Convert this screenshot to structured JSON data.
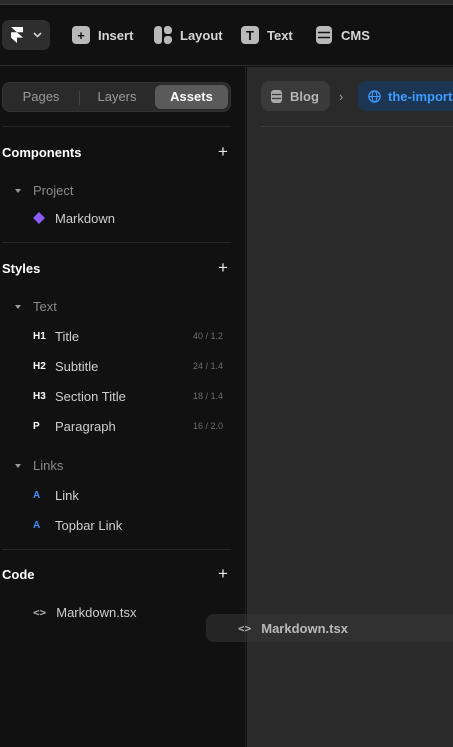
{
  "toolbar": {
    "items": [
      {
        "label": "Insert",
        "icon": "plus-square-icon"
      },
      {
        "label": "Layout",
        "icon": "layout-grid-icon"
      },
      {
        "label": "Text",
        "icon": "text-t-icon"
      },
      {
        "label": "CMS",
        "icon": "database-icon"
      }
    ]
  },
  "sidebar": {
    "tabs": [
      "Pages",
      "Layers",
      "Assets"
    ],
    "active_tab": "Assets",
    "components": {
      "title": "Components",
      "group": "Project",
      "items": [
        {
          "label": "Markdown",
          "icon": "component-diamond-icon"
        }
      ]
    },
    "styles": {
      "title": "Styles",
      "text_group": "Text",
      "text_items": [
        {
          "tag": "H1",
          "label": "Title",
          "meta": "40 / 1.2"
        },
        {
          "tag": "H2",
          "label": "Subtitle",
          "meta": "24 / 1.4"
        },
        {
          "tag": "H3",
          "label": "Section Title",
          "meta": "18 / 1.4"
        },
        {
          "tag": "P",
          "label": "Paragraph",
          "meta": "16 / 2.0"
        }
      ],
      "links_group": "Links",
      "link_items": [
        {
          "tag": "A",
          "label": "Link"
        },
        {
          "tag": "A",
          "label": "Topbar Link"
        }
      ]
    },
    "code": {
      "title": "Code",
      "items": [
        {
          "label": "Markdown.tsx",
          "icon": "code-brackets-icon"
        }
      ]
    }
  },
  "canvas": {
    "breadcrumb": {
      "first": "Blog",
      "second": "the-importa"
    }
  },
  "drag_ghost": {
    "label": "Markdown.tsx"
  },
  "colors": {
    "accent": "#3e9bff",
    "component": "#8b5cf6",
    "link_tag": "#3a8ef6"
  }
}
